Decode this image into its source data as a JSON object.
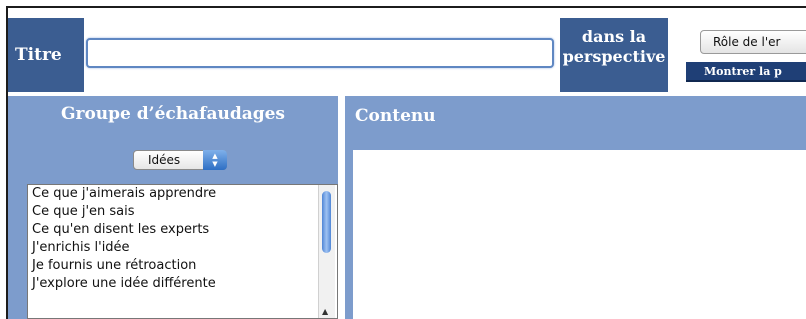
{
  "header": {
    "title_label": "Titre",
    "title_input_value": "",
    "perspective_line1": "dans la",
    "perspective_line2": "perspective",
    "role_button": "Rôle de l'er",
    "show_button": "Montrer la p"
  },
  "scaffold": {
    "title": "Groupe d’échafaudages",
    "select_value": "Idées",
    "items": [
      "Ce que j'aimerais apprendre",
      "Ce que j'en sais",
      "Ce qu'en disent les experts",
      "J'enrichis l'idée",
      "Je fournis une rétroaction",
      "J'explore une idée différente"
    ]
  },
  "content": {
    "title": "Contenu"
  },
  "colors": {
    "dark_blue": "#3b5d91",
    "panel_blue": "#7d9ccc",
    "button_navy": "#1f3f76"
  }
}
